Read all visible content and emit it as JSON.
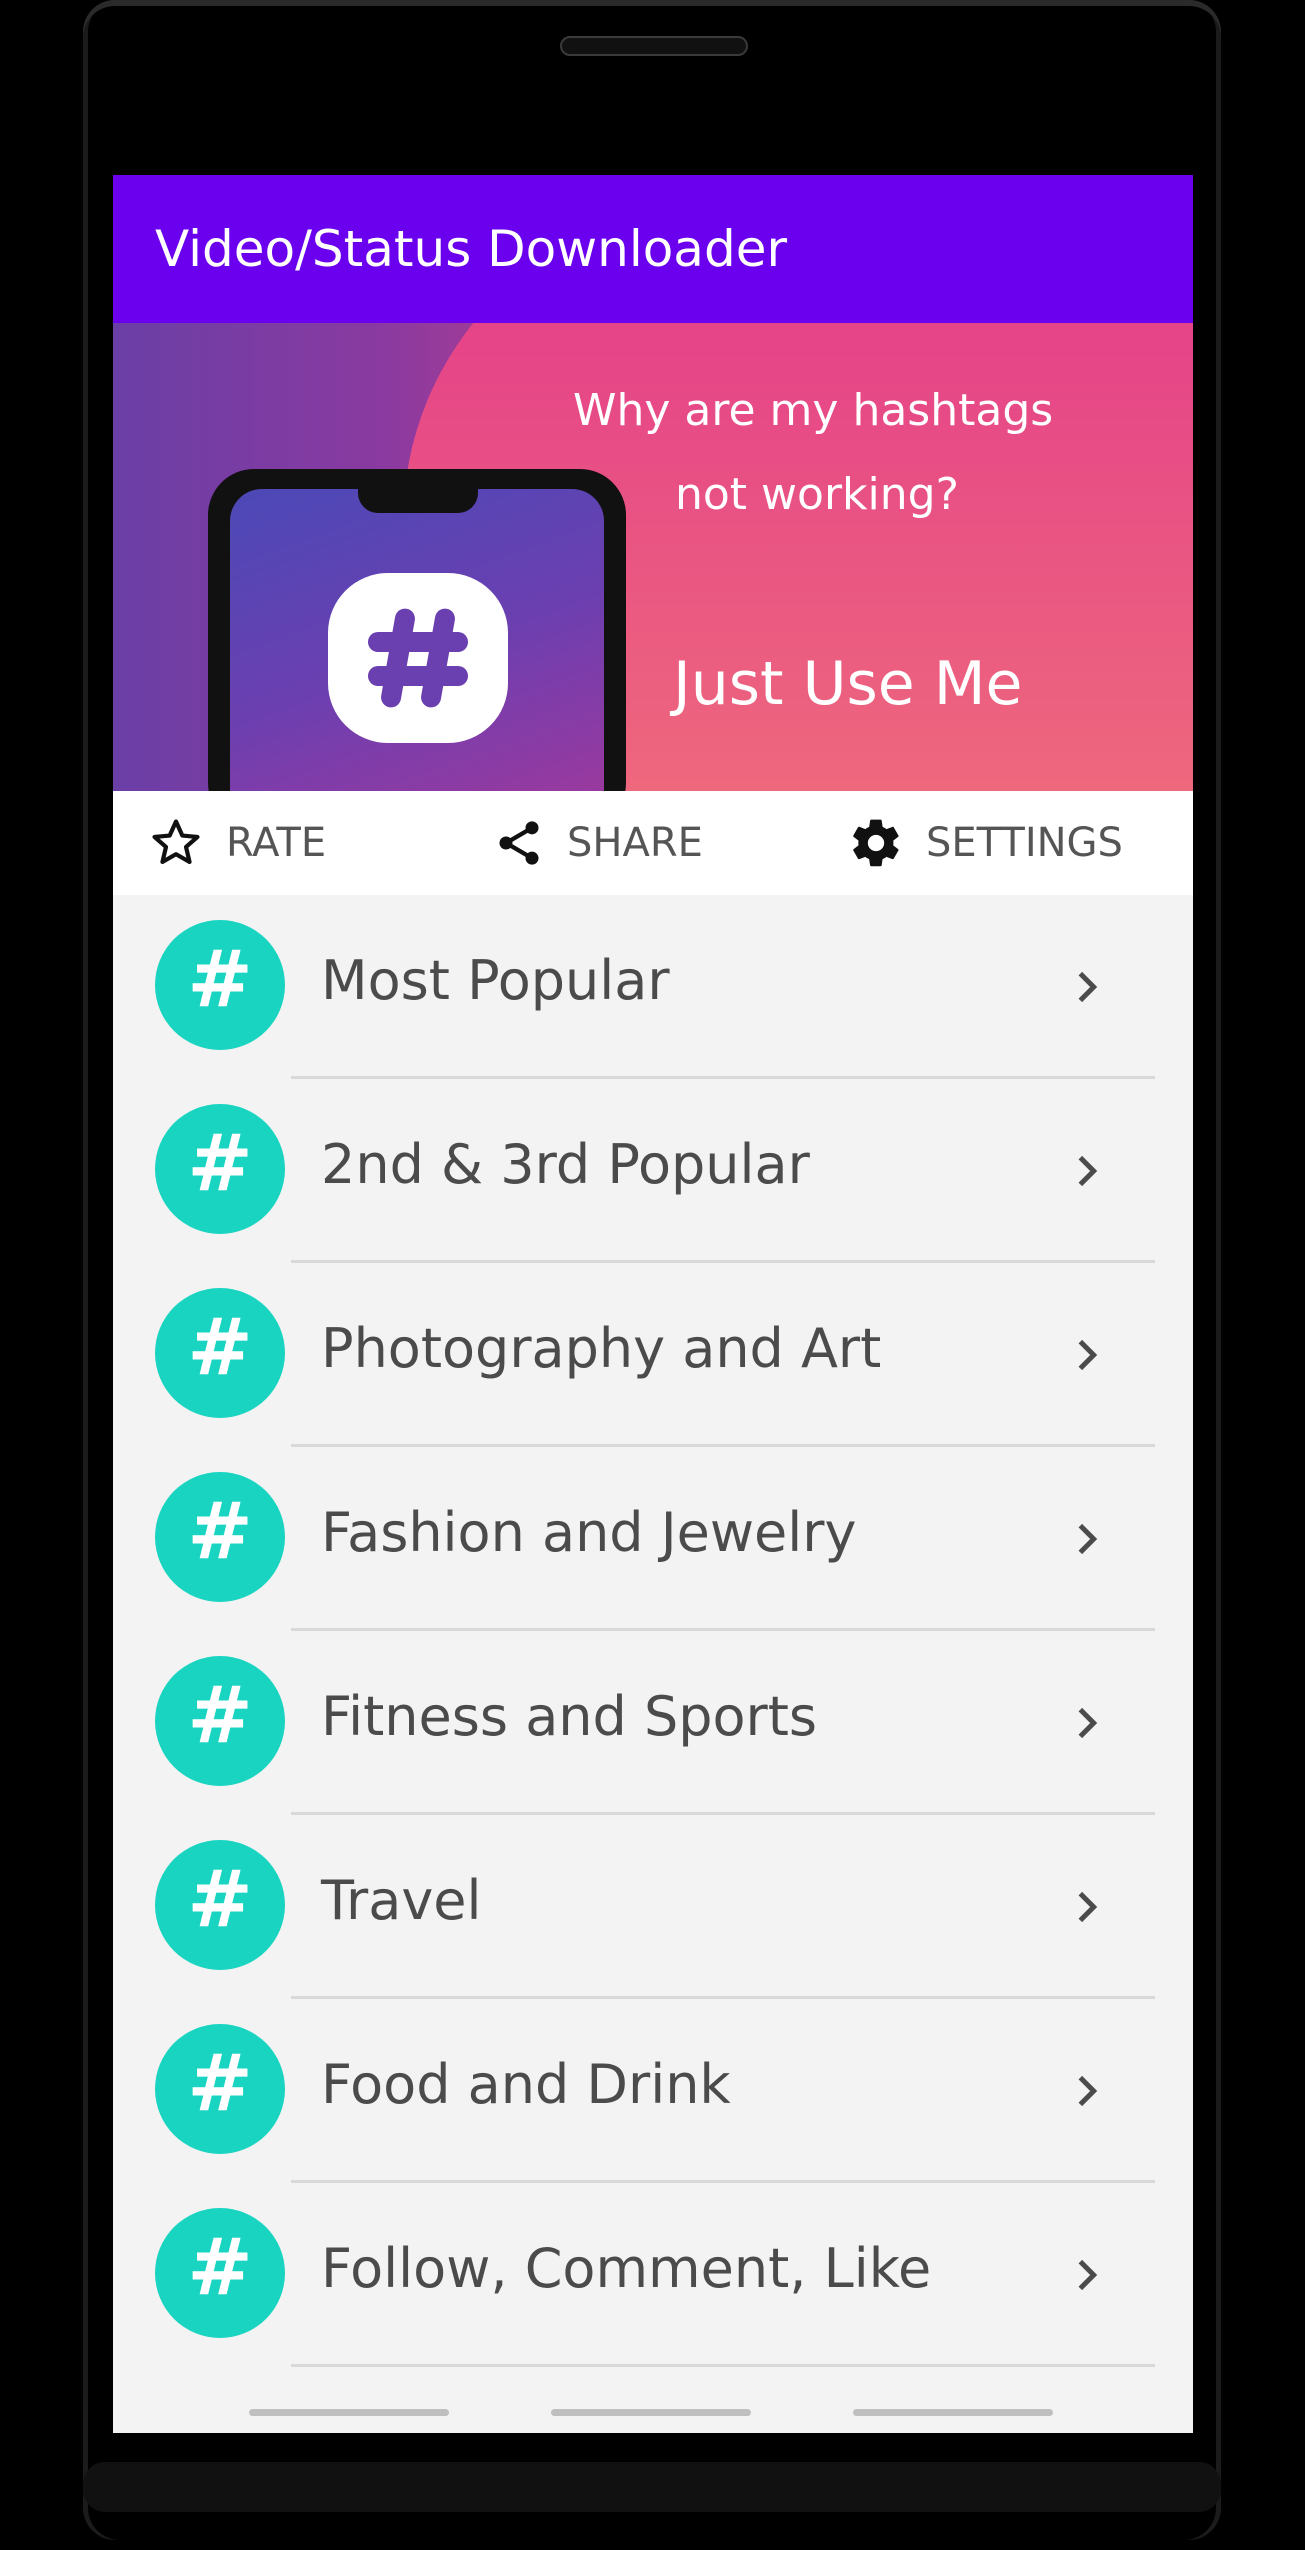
{
  "app": {
    "title": "Video/Status Downloader"
  },
  "banner": {
    "line1": "Why are my hashtags",
    "line2": "not working?",
    "line3": "Just Use Me"
  },
  "actions": {
    "rate": "RATE",
    "share": "SHARE",
    "settings": "SETTINGS"
  },
  "list": {
    "icon_glyph": "#",
    "items": [
      {
        "label": "Most Popular"
      },
      {
        "label": "2nd & 3rd Popular"
      },
      {
        "label": "Photography and Art"
      },
      {
        "label": "Fashion and Jewelry"
      },
      {
        "label": "Fitness and Sports"
      },
      {
        "label": "Travel"
      },
      {
        "label": "Food and Drink"
      },
      {
        "label": "Follow, Comment, Like"
      }
    ]
  },
  "colors": {
    "appbar": "#6a00ee",
    "accent": "#19d4c0"
  }
}
